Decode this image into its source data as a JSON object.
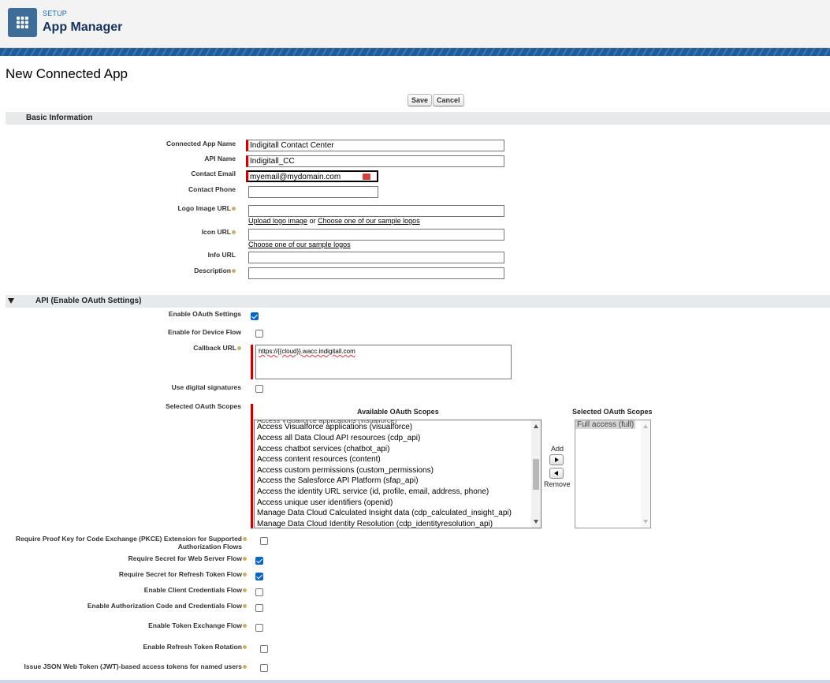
{
  "header": {
    "setup": "SETUP",
    "title": "App Manager"
  },
  "page": {
    "title": "New Connected App"
  },
  "toolbar": {
    "save": "Save",
    "cancel": "Cancel"
  },
  "basic": {
    "title": "Basic Information",
    "app_name_label": "Connected App Name",
    "app_name_value": "Indigitall Contact Center",
    "api_name_label": "API Name",
    "api_name_value": "Indigitall_CC",
    "email_label": "Contact Email",
    "email_value": "myemail@mydomain.com",
    "phone_label": "Contact Phone",
    "logo_label": "Logo Image URL",
    "upload_logo": "Upload logo image",
    "or": "or",
    "sample_logos": "Choose one of our sample logos",
    "icon_label": "Icon URL",
    "icon_sample": "Choose one of our sample logos",
    "info_label": "Info URL",
    "desc_label": "Description"
  },
  "api": {
    "title": "API (Enable OAuth Settings)",
    "enable_oauth": "Enable OAuth Settings",
    "device_flow": "Enable for Device Flow",
    "callback_label": "Callback URL",
    "callback_value": "https://{{cloud}}.wacc.indigitall.com",
    "digital_sig": "Use digital signatures",
    "scopes_label": "Selected OAuth Scopes",
    "available_title": "Available OAuth Scopes",
    "selected_title": "Selected OAuth Scopes",
    "add": "Add",
    "remove": "Remove",
    "available": [
      "Access Visualforce applications (visualforce)",
      "Access all Data Cloud API resources (cdp_api)",
      "Access chatbot services (chatbot_api)",
      "Access content resources (content)",
      "Access custom permissions (custom_permissions)",
      "Access the Salesforce API Platform (sfap_api)",
      "Access the identity URL service (id, profile, email, address, phone)",
      "Access unique user identifiers (openid)",
      "Manage Data Cloud Calculated Insight data (cdp_calculated_insight_api)",
      "Manage Data Cloud Identity Resolution (cdp_identityresolution_api)"
    ],
    "selected": [
      "Full access (full)"
    ],
    "pkce_1": "Require Proof Key for Code Exchange (PKCE) Extension for Supported",
    "pkce_2": "Authorization Flows",
    "secret_web": "Require Secret for Web Server Flow",
    "secret_refresh": "Require Secret for Refresh Token Flow",
    "client_cred": "Enable Client Credentials Flow",
    "auth_code": "Enable Authorization Code and Credentials Flow",
    "token_exchange": "Enable Token Exchange Flow",
    "refresh_rotation": "Enable Refresh Token Rotation",
    "jwt": "Issue JSON Web Token (JWT)-based access tokens for named users"
  },
  "colors": {
    "accent": "#0b65c2",
    "required": "#cc0000",
    "brand": "#3e6d97"
  }
}
